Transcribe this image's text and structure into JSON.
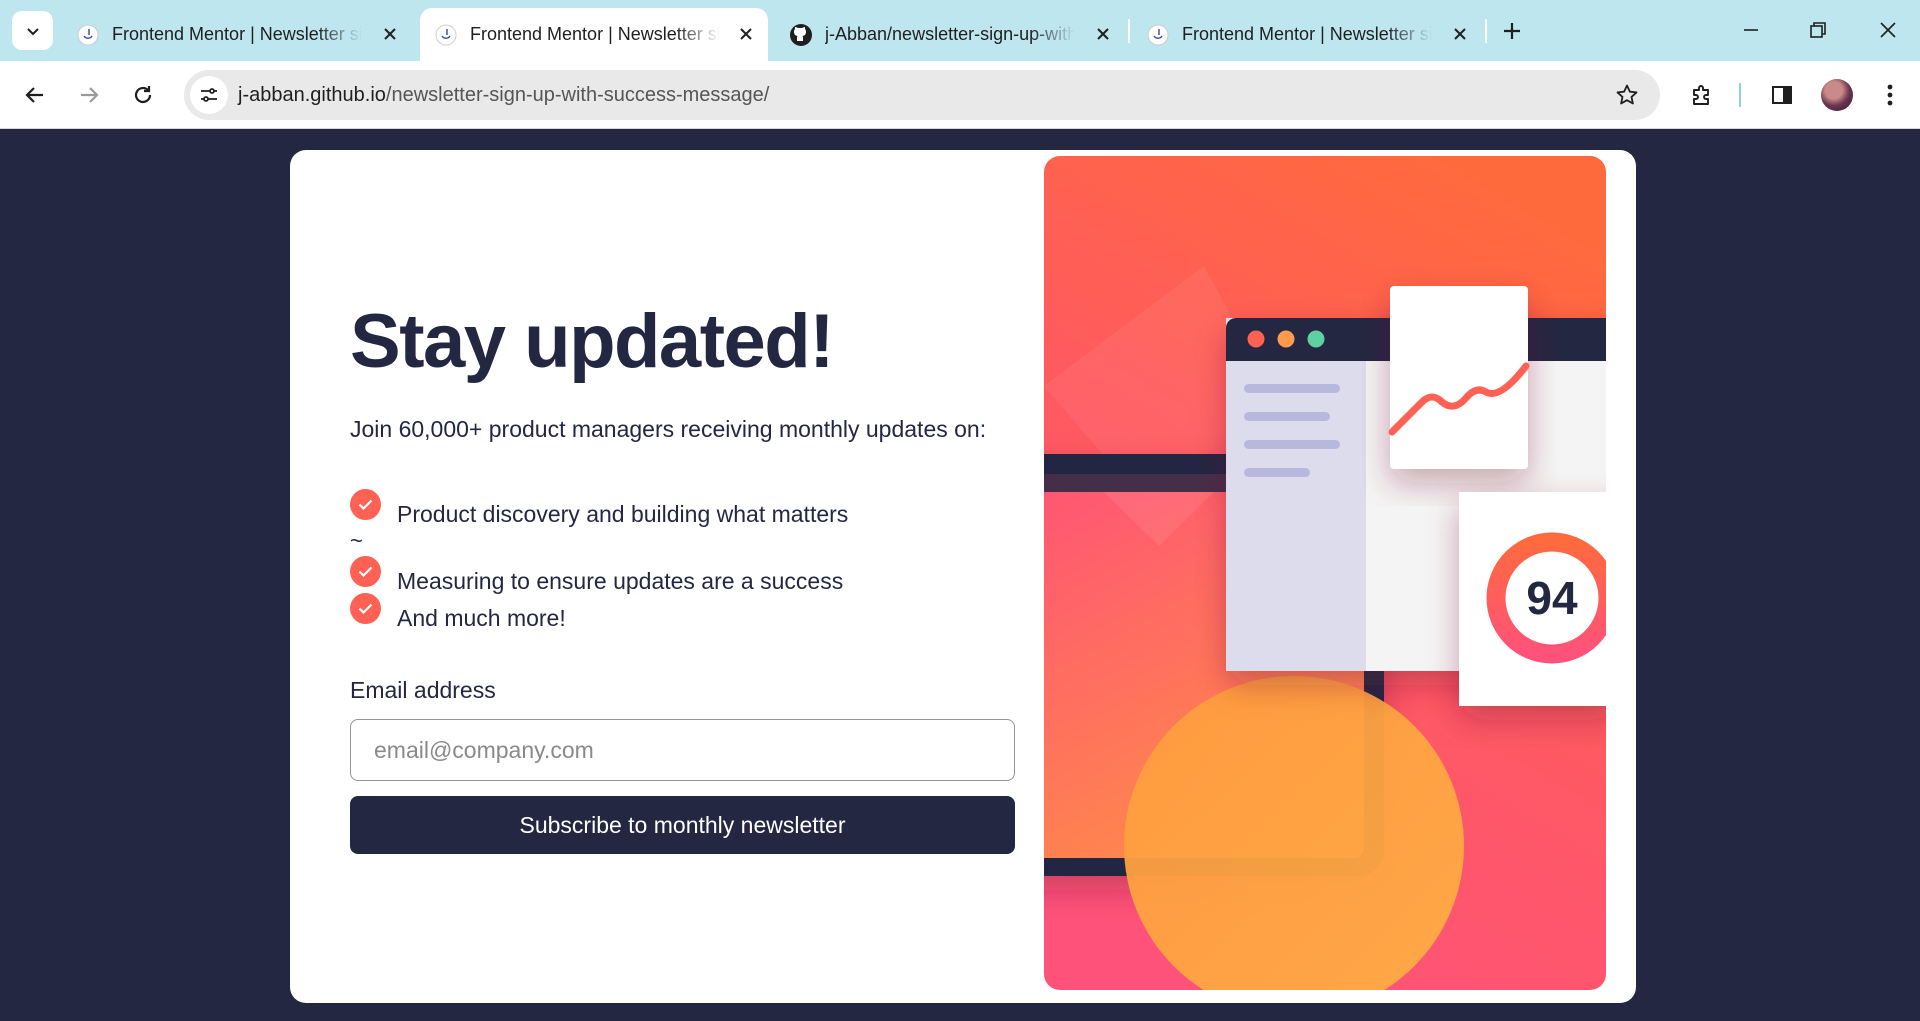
{
  "browser": {
    "tabs": [
      {
        "title": "Frontend Mentor | Newsletter sign-up",
        "active": false,
        "favicon": "frontend-mentor-icon"
      },
      {
        "title": "Frontend Mentor | Newsletter sign-up",
        "active": true,
        "favicon": "frontend-mentor-icon"
      },
      {
        "title": "j-Abban/newsletter-sign-up-with",
        "active": false,
        "favicon": "github-icon"
      },
      {
        "title": "Frontend Mentor | Newsletter sign-up",
        "active": false,
        "favicon": "frontend-mentor-icon"
      }
    ],
    "url_domain": "j-abban.github.io",
    "url_path": "/newsletter-sign-up-with-success-message/"
  },
  "page": {
    "headline": "Stay updated!",
    "intro": "Join 60,000+ product managers receiving monthly updates on:",
    "benefits": [
      "Product discovery and building what matters",
      "Measuring to ensure updates are a success",
      "And much more!"
    ],
    "stray_char": "~",
    "email_label": "Email address",
    "email_placeholder": "email@company.com",
    "subscribe_label": "Subscribe to monthly newsletter",
    "illustration_score": "94"
  },
  "colors": {
    "page_bg": "#242742",
    "accent": "#ff6155",
    "dark": "#242742",
    "tabbar": "#bde6ef"
  }
}
